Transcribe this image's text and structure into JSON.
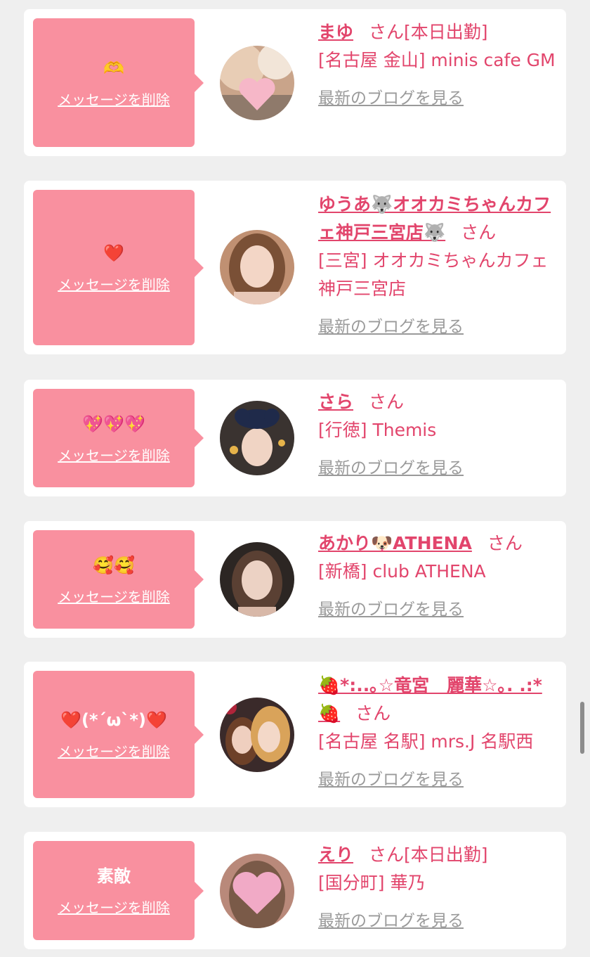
{
  "theme": {
    "accent": "#e2456c",
    "bubble": "#f9909f",
    "card_bg": "#ffffff",
    "page_bg": "#efefef",
    "link_gray": "#9a9a9a"
  },
  "messages": [
    {
      "message": "🫶",
      "delete_label": "メッセージを削除",
      "name": "まゆ",
      "suffix": "さん[本日出勤]",
      "shop": "[名古屋 金山] minis cafe GM",
      "blog_label": "最新のブログを見る",
      "avatar_icon": "avatar-heart-sticker"
    },
    {
      "message": "❤️",
      "delete_label": "メッセージを削除",
      "name": "ゆうあ🐺オオカミちゃんカフェ神戸三宮店🐺",
      "suffix": "さん",
      "shop": "[三宮] オオカミちゃんカフェ神戸三宮店",
      "blog_label": "最新のブログを見る",
      "avatar_icon": "avatar-portrait"
    },
    {
      "message": "💖💖💖",
      "delete_label": "メッセージを削除",
      "name": "さら",
      "suffix": "さん",
      "shop": "[行徳] Themis",
      "blog_label": "最新のブログを見る",
      "avatar_icon": "avatar-ribbon-portrait"
    },
    {
      "message": "🥰🥰",
      "delete_label": "メッセージを削除",
      "name": "あかり🐶ATHENA",
      "suffix": "さん",
      "shop": "[新橋] club ATHENA",
      "blog_label": "最新のブログを見る",
      "avatar_icon": "avatar-portrait"
    },
    {
      "message": "❤️(*´ω`*)❤️",
      "delete_label": "メッセージを削除",
      "name": "🍓*:..｡☆竜宮　麗華☆｡. .:*🍓",
      "suffix": "さん",
      "shop": "[名古屋 名駅] mrs.J 名駅西",
      "blog_label": "最新のブログを見る",
      "avatar_icon": "avatar-duo-portrait"
    },
    {
      "message": "素敵",
      "delete_label": "メッセージを削除",
      "name": "えり",
      "suffix": "さん[本日出勤]",
      "shop": "[国分町] 華乃",
      "blog_label": "最新のブログを見る",
      "avatar_icon": "avatar-heart-sticker"
    }
  ]
}
